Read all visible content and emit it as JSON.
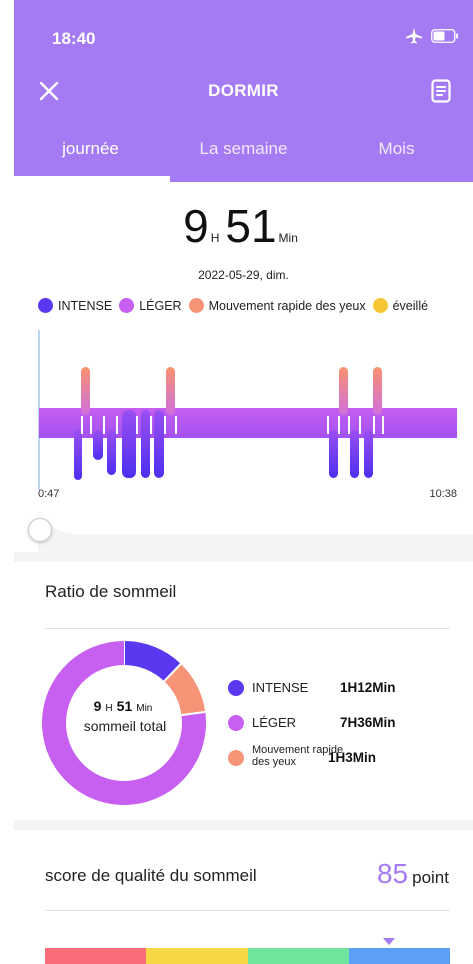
{
  "status_bar": {
    "time": "18:40",
    "icons": [
      "airplane-icon",
      "battery-icon"
    ]
  },
  "header": {
    "title": "DORMIR",
    "close_icon": "close-icon",
    "report_icon": "report-icon",
    "tabs": [
      {
        "label": "journée",
        "active": true
      },
      {
        "label": "La semaine",
        "active": false
      },
      {
        "label": "Mois",
        "active": false
      }
    ]
  },
  "summary": {
    "hours": "9",
    "hours_unit": "H",
    "minutes": "51",
    "minutes_unit": "Min",
    "date": "2022-05-29, dim."
  },
  "legend": [
    {
      "label": "INTENSE",
      "color": "#5a38f0"
    },
    {
      "label": "LÉGER",
      "color": "#c75ff0"
    },
    {
      "label": "Mouvement rapide des yeux",
      "color": "#f79478"
    },
    {
      "label": "éveillé",
      "color": "#f6c636"
    }
  ],
  "hypnogram": {
    "start_time": "0:47",
    "end_time": "10:38",
    "colors": {
      "deep": "#5a38f0",
      "light": "#c75ff0",
      "rem": "#f79478"
    }
  },
  "ratio": {
    "title": "Ratio de sommeil",
    "center_hours": "9",
    "center_h_unit": "H",
    "center_minutes": "51",
    "center_min_unit": "Min",
    "center_caption": "sommeil total",
    "items": [
      {
        "name": "INTENSE",
        "value": "1H12Min",
        "minutes": 72,
        "color": "#5a38f0"
      },
      {
        "name": "LÉGER",
        "value": "7H36Min",
        "minutes": 456,
        "color": "#c75ff0"
      },
      {
        "name": "Mouvement rapide des yeux",
        "value": "1H3Min",
        "minutes": 63,
        "color": "#f79478"
      }
    ]
  },
  "score": {
    "label": "score de qualité du sommeil",
    "value": "85",
    "unit": "point",
    "level": 85,
    "segments": [
      "#fa6d78",
      "#f6d846",
      "#6ee49c",
      "#5b9ff7"
    ]
  }
}
